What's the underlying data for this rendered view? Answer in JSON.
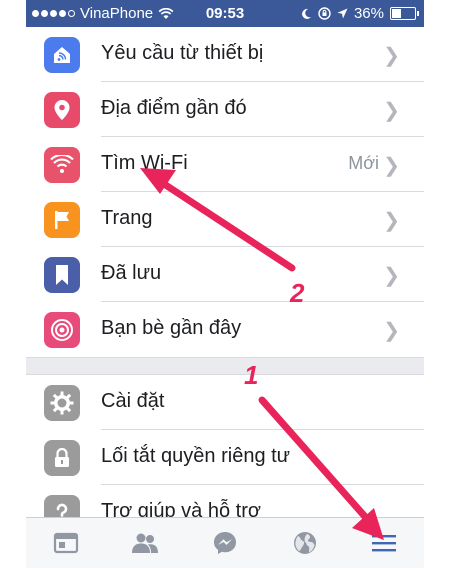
{
  "status_bar": {
    "carrier": "VinaPhone",
    "time": "09:53",
    "battery": "36%",
    "battery_level": 0.36
  },
  "menu": {
    "group1": [
      {
        "label": "Yêu cầu từ thiết bị",
        "icon": "device-request-icon",
        "color": "#4b7bec"
      },
      {
        "label": "Địa điểm gần đó",
        "icon": "location-pin-icon",
        "color": "#e84b6a"
      },
      {
        "label": "Tìm Wi-Fi",
        "icon": "wifi-icon",
        "color": "#e8526a",
        "badge": "Mới"
      },
      {
        "label": "Trang",
        "icon": "flag-icon",
        "color": "#f7931e"
      },
      {
        "label": "Đã lưu",
        "icon": "bookmark-icon",
        "color": "#4a5fa8"
      },
      {
        "label": "Bạn bè gần đây",
        "icon": "nearby-friends-icon",
        "color": "#e84b7a"
      }
    ],
    "group2": [
      {
        "label": "Cài đặt",
        "icon": "gear-icon"
      },
      {
        "label": "Lối tắt quyền riêng tư",
        "icon": "lock-icon"
      },
      {
        "label": "Trợ giúp và hỗ trợ",
        "icon": "help-icon"
      }
    ]
  },
  "tab_bar": {
    "tabs": [
      "news-feed-icon",
      "friends-icon",
      "messenger-icon",
      "globe-icon",
      "menu-icon"
    ],
    "active_color": "#4267b2"
  },
  "annotations": {
    "arrow_color": "#e8245a",
    "label_1": "1",
    "label_2": "2"
  }
}
